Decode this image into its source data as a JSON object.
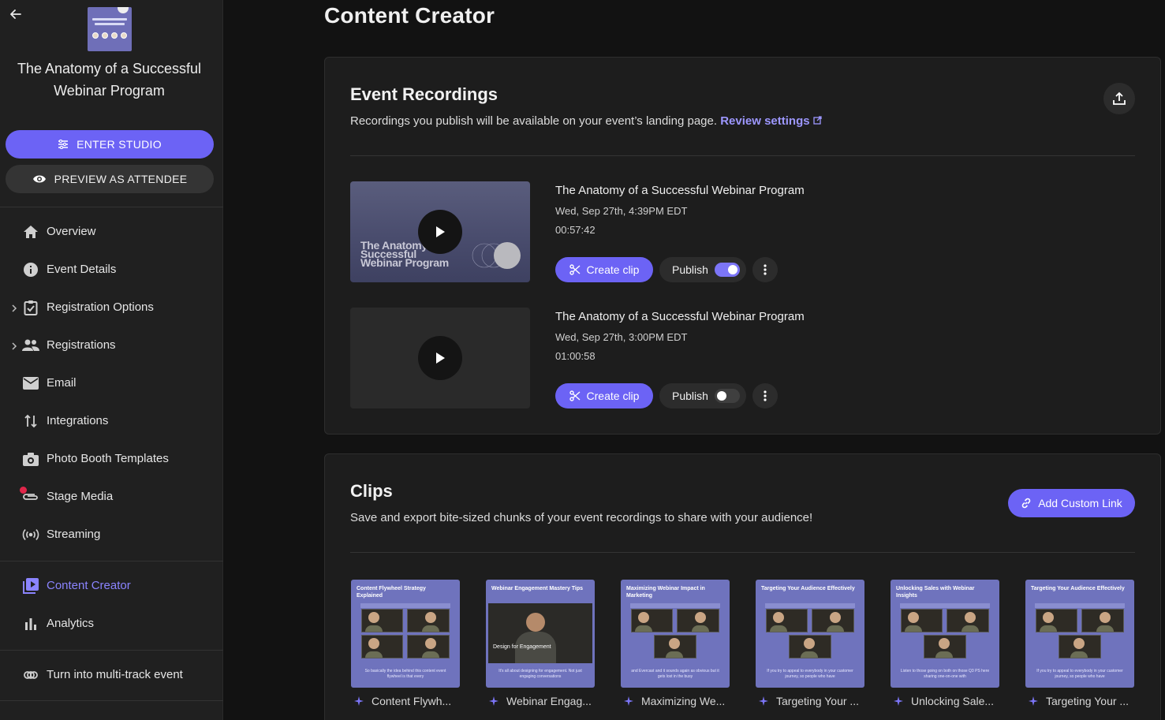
{
  "sidebar": {
    "event_title": "The Anatomy of a Successful Webinar Program",
    "enter_studio": "ENTER STUDIO",
    "preview_attendee": "PREVIEW AS ATTENDEE",
    "nav": [
      {
        "label": "Overview",
        "icon": "home-icon"
      },
      {
        "label": "Event Details",
        "icon": "info-icon"
      },
      {
        "label": "Registration Options",
        "icon": "checklist-icon",
        "expandable": true
      },
      {
        "label": "Registrations",
        "icon": "people-icon",
        "expandable": true
      },
      {
        "label": "Email",
        "icon": "mail-icon"
      },
      {
        "label": "Integrations",
        "icon": "arrows-icon"
      },
      {
        "label": "Photo Booth Templates",
        "icon": "camera-icon"
      },
      {
        "label": "Stage Media",
        "icon": "paperclip-icon"
      },
      {
        "label": "Streaming",
        "icon": "broadcast-icon"
      }
    ],
    "nav2": [
      {
        "label": "Content Creator",
        "icon": "video-library-icon",
        "active": true
      },
      {
        "label": "Analytics",
        "icon": "bar-chart-icon"
      }
    ],
    "multi_track": "Turn into multi-track event"
  },
  "main": {
    "page_title": "Content Creator",
    "recordings": {
      "title": "Event Recordings",
      "subtitle": "Recordings you publish will be available on your event’s landing page.",
      "review_link": "Review settings",
      "items": [
        {
          "title": "The Anatomy of a Successful Webinar Program",
          "date": "Wed, Sep 27th, 4:39PM EDT",
          "duration": "00:57:42",
          "clip_label": "Create clip",
          "publish_label": "Publish",
          "published": true,
          "thumb_text": "The Anatomy of a Successful Webinar Program"
        },
        {
          "title": "The Anatomy of a Successful Webinar Program",
          "date": "Wed, Sep 27th, 3:00PM EDT",
          "duration": "01:00:58",
          "clip_label": "Create clip",
          "publish_label": "Publish",
          "published": false
        }
      ]
    },
    "clips": {
      "title": "Clips",
      "subtitle": "Save and export bite-sized chunks of your event recordings to share with your audience!",
      "add_link": "Add Custom Link",
      "items": [
        {
          "thumb_title": "Content Flywheel Strategy Explained",
          "caption": "So basically the idea behind this content event flywheel is that every",
          "label": "Content Flywh..."
        },
        {
          "thumb_title": "Webinar Engagement Mastery Tips",
          "caption": "It's all about designing for engagement. Not just engaging conversations",
          "label": "Webinar Engag...",
          "overlay": "Design for Engagement"
        },
        {
          "thumb_title": "Maximizing Webinar Impact in Marketing",
          "caption": "and Evercast and it sounds again as obvious but it gets lost in the busy",
          "label": "Maximizing We..."
        },
        {
          "thumb_title": "Targeting Your Audience Effectively",
          "caption": "If you try to appeal to everybody in your customer journey, so people who have",
          "label": "Targeting Your ..."
        },
        {
          "thumb_title": "Unlocking Sales with Webinar Insights",
          "caption": "Listen to those going on both on those Q3 PS here sharing one-on-one with",
          "label": "Unlocking Sale..."
        },
        {
          "thumb_title": "Targeting Your Audience Effectively",
          "caption": "If you try to appeal to everybody in your customer journey, so people who have",
          "label": "Targeting Your ..."
        }
      ]
    }
  },
  "colors": {
    "accent": "#6c63f5",
    "active_nav": "#8b84ff",
    "notification": "#e0264a"
  }
}
